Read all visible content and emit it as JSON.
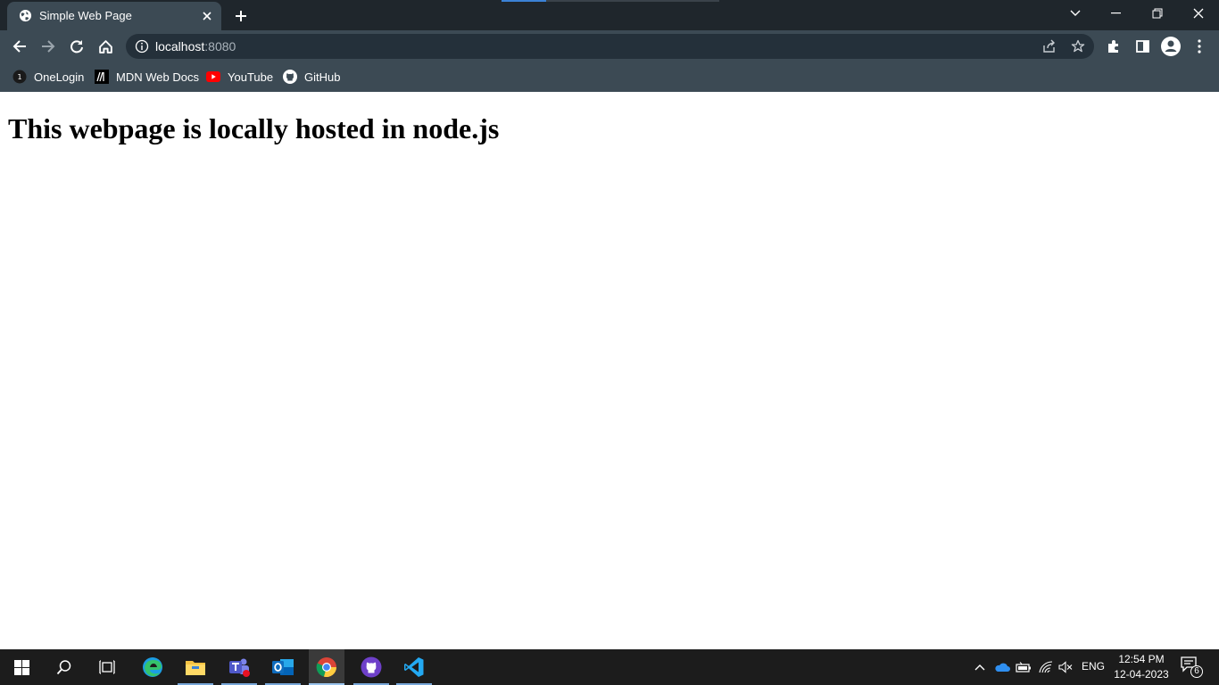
{
  "browser": {
    "tab": {
      "title": "Simple Web Page",
      "icon": "globe-icon"
    },
    "window_controls": [
      "tab-search-icon",
      "minimize-icon",
      "restore-icon",
      "close-icon"
    ],
    "url": {
      "host": "localhost",
      "port": ":8080"
    },
    "bookmarks": [
      {
        "label": "OneLogin",
        "icon": "onelogin-icon"
      },
      {
        "label": "MDN Web Docs",
        "icon": "mdn-icon"
      },
      {
        "label": "YouTube",
        "icon": "youtube-icon"
      },
      {
        "label": "GitHub",
        "icon": "github-icon"
      }
    ]
  },
  "page": {
    "heading": "This webpage is locally hosted in node.js"
  },
  "taskbar": {
    "apps": [
      "windows-start",
      "search",
      "task-view",
      "edge",
      "file-explorer",
      "teams",
      "outlook",
      "chrome",
      "github-desktop",
      "vscode"
    ],
    "tray": {
      "lang": "ENG",
      "time": "12:54 PM",
      "date": "12-04-2023",
      "notifications": "6"
    }
  },
  "colors": {
    "tabstrip": "#1f262c",
    "toolbar": "#3c4a54",
    "omnibox": "#24303a",
    "taskbar": "#1c1c1c"
  }
}
